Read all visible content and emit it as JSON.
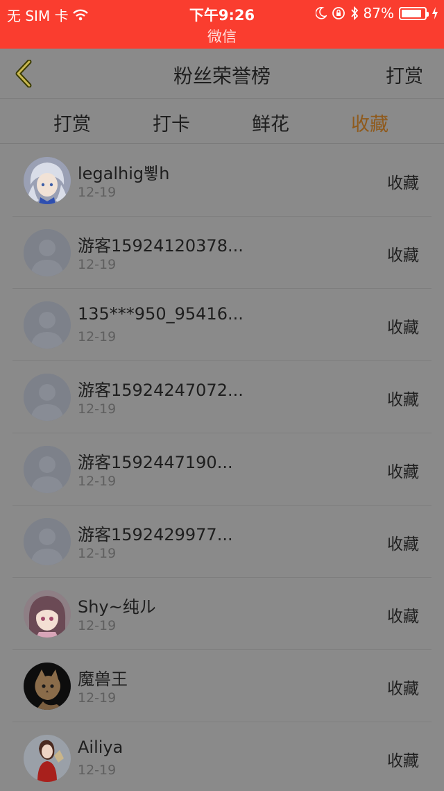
{
  "status_bar": {
    "carrier": "无 SIM 卡",
    "time": "下午9:26",
    "app": "微信",
    "battery_percent": "87%",
    "battery_level": 0.87,
    "icons": [
      "wifi-icon",
      "moon-icon",
      "rotation-lock-icon",
      "bluetooth-icon",
      "battery-icon",
      "charging-icon"
    ]
  },
  "nav": {
    "title": "粉丝荣誉榜",
    "action": "打赏"
  },
  "tabs": [
    {
      "label": "打赏",
      "active": false
    },
    {
      "label": "打卡",
      "active": false
    },
    {
      "label": "鲜花",
      "active": false
    },
    {
      "label": "收藏",
      "active": true
    }
  ],
  "colors": {
    "status_bar": "#fa3d2f",
    "background": "#8a8a8a",
    "active_tab": "#8f5a1c"
  },
  "fans": [
    {
      "name": "legalhig뾯h",
      "date": "12-19",
      "action": "收藏",
      "avatar": "anime-girl-white-hair"
    },
    {
      "name": "游客15924120378...",
      "date": "12-19",
      "action": "收藏",
      "avatar": "default-user"
    },
    {
      "name": "135***950_95416...",
      "date": "12-19",
      "action": "收藏",
      "avatar": "default-user"
    },
    {
      "name": "游客15924247072...",
      "date": "12-19",
      "action": "收藏",
      "avatar": "default-user"
    },
    {
      "name": "游客1592447190...",
      "date": "12-19",
      "action": "收藏",
      "avatar": "default-user"
    },
    {
      "name": "游客1592429977...",
      "date": "12-19",
      "action": "收藏",
      "avatar": "default-user"
    },
    {
      "name": "Shy~纯ル",
      "date": "12-19",
      "action": "收藏",
      "avatar": "anime-girl-pink"
    },
    {
      "name": "魔兽王",
      "date": "12-19",
      "action": "收藏",
      "avatar": "cat-photo"
    },
    {
      "name": "Ailiya",
      "date": "12-19",
      "action": "收藏",
      "avatar": "girl-red-dress"
    }
  ]
}
